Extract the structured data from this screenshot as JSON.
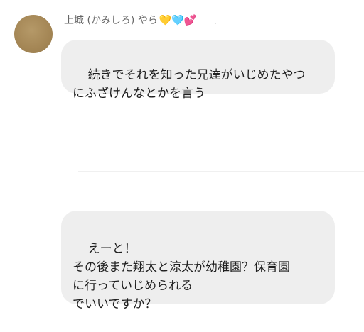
{
  "message_1": {
    "sender": "上城 (かみしろ) やら",
    "sender_emoji": "💛🩵💕",
    "text": "続きでそれを知った兄達がいじめたやつ\nにふざけんなとかを言う"
  },
  "message_2": {
    "text": "えーと！\nその後また翔太と涼太が幼稚園？保育園\nに行っていじめられる\nでいいですか？"
  }
}
